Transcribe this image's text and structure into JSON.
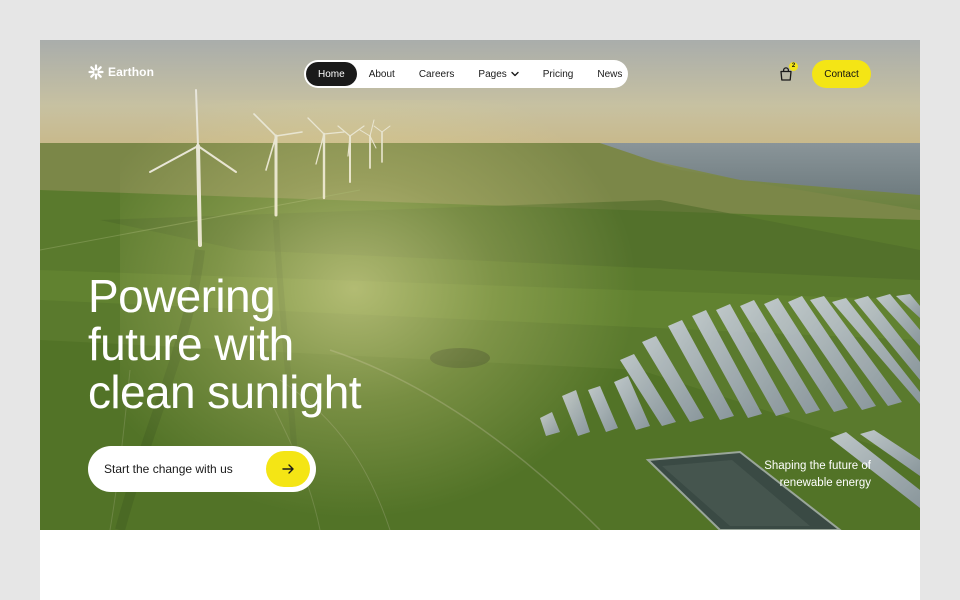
{
  "brand": {
    "name": "Earthon",
    "logo_icon": "sun-burst-icon"
  },
  "nav": {
    "items": [
      {
        "label": "Home",
        "active": true
      },
      {
        "label": "About",
        "active": false
      },
      {
        "label": "Careers",
        "active": false
      },
      {
        "label": "Pages",
        "active": false,
        "has_dropdown": true
      },
      {
        "label": "Pricing",
        "active": false
      },
      {
        "label": "News",
        "active": false
      }
    ]
  },
  "cart": {
    "icon": "shopping-bag-icon",
    "count": "2"
  },
  "contact_label": "Contact",
  "hero": {
    "headline": [
      "Powering",
      "future with",
      "clean sunlight"
    ],
    "cta_label": "Start the change with us",
    "cta_icon": "arrow-right-icon",
    "tagline": [
      "Shaping the future of",
      "renewable energy"
    ]
  },
  "colors": {
    "accent": "#f4e515",
    "dark": "#1a1a1a",
    "page_bg": "#e6e6e6"
  }
}
